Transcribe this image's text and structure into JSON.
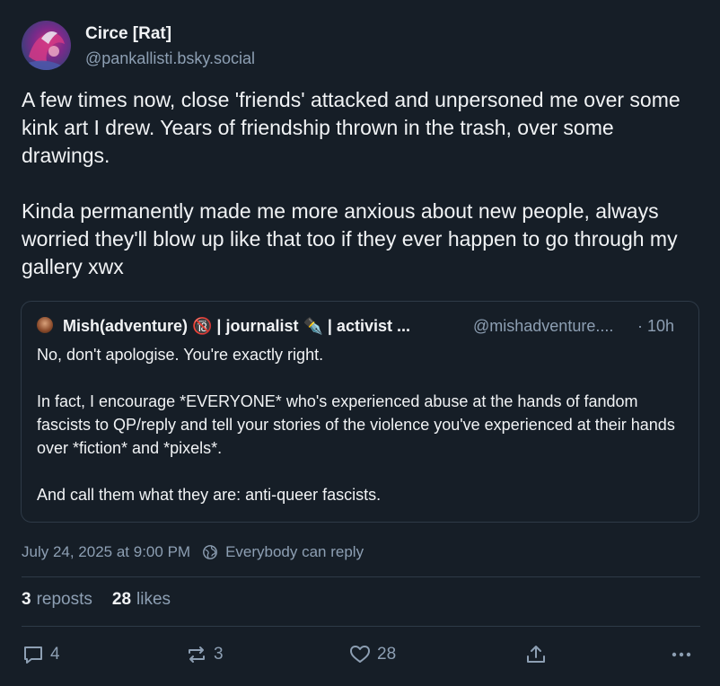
{
  "author": {
    "name": "Circe [Rat]",
    "handle": "@pankallisti.bsky.social",
    "avatar_icon": "avatar-image"
  },
  "post": {
    "text": "A few times now, close 'friends' attacked and unpersoned me over some kink art I drew. Years of friendship thrown in the trash, over some drawings.\n\nKinda permanently made me more anxious about new people, always worried they'll blow up like that too if they ever happen to go through my gallery xwx",
    "timestamp": "July 24, 2025 at 9:00 PM",
    "reply_setting": "Everybody can reply"
  },
  "quote": {
    "name": "Mish(adventure) 🔞 | journalist ✒️ | activist ...",
    "handle": "@mishadventure....",
    "time": "· 10h",
    "text": "No, don't apologise. You're exactly right.\n\nIn fact, I encourage *EVERYONE* who's experienced abuse at the hands of fandom fascists to QP/reply and tell your stories of the violence you've experienced at their hands over *fiction* and *pixels*.\n\nAnd call them what they are: anti-queer fascists."
  },
  "stats": {
    "reposts_count": "3",
    "reposts_label": "reposts",
    "likes_count": "28",
    "likes_label": "likes"
  },
  "actions": {
    "reply_count": "4",
    "repost_count": "3",
    "like_count": "28"
  },
  "colors": {
    "background": "#161e27",
    "text": "#f1f3f5",
    "muted": "#8d9fb3",
    "border": "#2e3a47"
  }
}
